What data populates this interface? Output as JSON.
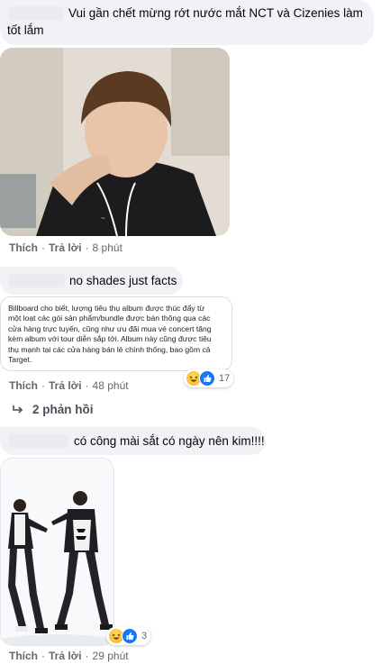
{
  "comments": [
    {
      "text_line1": "Vui gần chết mừng rớt nước mắt NCT và Cizenies làm",
      "text_line2": "tốt lắm",
      "like_label": "Thích",
      "reply_label": "Trả lời",
      "time": "8 phút"
    },
    {
      "text": "no shades just facts",
      "quote_lines": [
        "Billboard cho biết, lượng tiêu thụ album được thúc đẩy từ",
        "một loạt các gói sản phẩm/bundle được bán thông qua các",
        "cửa hàng trực tuyến, cũng như ưu đãi mua vé concert tặng",
        "kèm album với tour diễn sắp tới. Album này cũng được tiêu",
        "thụ mạnh tại các cửa hàng bán lẻ chính thống, bao gồm cả",
        "Target."
      ],
      "reaction_count": "17",
      "like_label": "Thích",
      "reply_label": "Trả lời",
      "time": "48 phút",
      "replies_label": "2 phản hồi"
    },
    {
      "text": "có công mài sắt có ngày nên kim!!!!",
      "reaction_count": "3",
      "like_label": "Thích",
      "reply_label": "Trả lời",
      "time": "29 phút"
    }
  ],
  "colors": {
    "bubble": "#f0f2f5",
    "meta_text": "#65676b",
    "like_blue": "#1877f2",
    "haha_yellow": "#f7b125"
  },
  "icons": [
    "haha-reaction-icon",
    "like-reaction-icon",
    "reply-arrow-icon"
  ]
}
